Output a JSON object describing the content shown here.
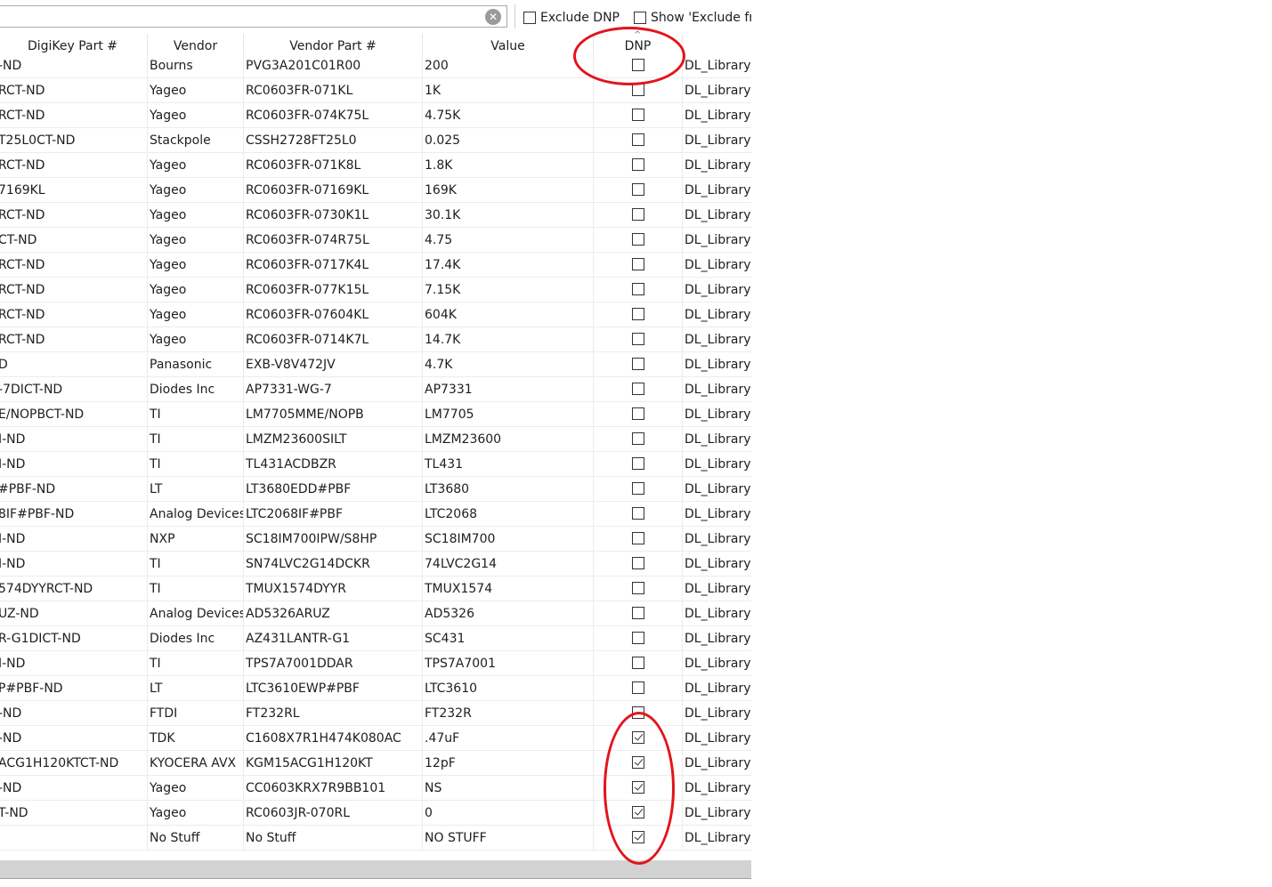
{
  "toolbar": {
    "search_value": "",
    "exclude_dnp_label": "Exclude DNP",
    "show_exclude_label": "Show 'Exclude fro"
  },
  "columns": [
    "DigiKey Part #",
    "Vendor",
    "Vendor Part #",
    "Value",
    "DNP"
  ],
  "rows": [
    {
      "digikey": "-ND",
      "vendor": "Bourns",
      "vendor_part": "PVG3A201C01R00",
      "value": "200",
      "dnp": false,
      "footprint": "DL_Library:"
    },
    {
      "digikey": "RCT-ND",
      "vendor": "Yageo",
      "vendor_part": "RC0603FR-071KL",
      "value": "1K",
      "dnp": false,
      "footprint": "DL_Library:"
    },
    {
      "digikey": "RCT-ND",
      "vendor": "Yageo",
      "vendor_part": "RC0603FR-074K75L",
      "value": "4.75K",
      "dnp": false,
      "footprint": "DL_Library:"
    },
    {
      "digikey": "T25L0CT-ND",
      "vendor": "Stackpole",
      "vendor_part": "CSSH2728FT25L0",
      "value": "0.025",
      "dnp": false,
      "footprint": "DL_Library:"
    },
    {
      "digikey": "RCT-ND",
      "vendor": "Yageo",
      "vendor_part": "RC0603FR-071K8L",
      "value": "1.8K",
      "dnp": false,
      "footprint": "DL_Library:"
    },
    {
      "digikey": "7169KL",
      "vendor": "Yageo",
      "vendor_part": "RC0603FR-07169KL",
      "value": "169K",
      "dnp": false,
      "footprint": "DL_Library:"
    },
    {
      "digikey": "RCT-ND",
      "vendor": "Yageo",
      "vendor_part": "RC0603FR-0730K1L",
      "value": "30.1K",
      "dnp": false,
      "footprint": "DL_Library:"
    },
    {
      "digikey": "CT-ND",
      "vendor": "Yageo",
      "vendor_part": "RC0603FR-074R75L",
      "value": "4.75",
      "dnp": false,
      "footprint": "DL_Library:"
    },
    {
      "digikey": "RCT-ND",
      "vendor": "Yageo",
      "vendor_part": "RC0603FR-0717K4L",
      "value": "17.4K",
      "dnp": false,
      "footprint": "DL_Library:"
    },
    {
      "digikey": "RCT-ND",
      "vendor": "Yageo",
      "vendor_part": "RC0603FR-077K15L",
      "value": "7.15K",
      "dnp": false,
      "footprint": "DL_Library:"
    },
    {
      "digikey": "RCT-ND",
      "vendor": "Yageo",
      "vendor_part": "RC0603FR-07604KL",
      "value": "604K",
      "dnp": false,
      "footprint": "DL_Library:"
    },
    {
      "digikey": "RCT-ND",
      "vendor": "Yageo",
      "vendor_part": "RC0603FR-0714K7L",
      "value": "14.7K",
      "dnp": false,
      "footprint": "DL_Library:"
    },
    {
      "digikey": "D",
      "vendor": "Panasonic",
      "vendor_part": "EXB-V8V472JV",
      "value": "4.7K",
      "dnp": false,
      "footprint": "DL_Library:"
    },
    {
      "digikey": "-7DICT-ND",
      "vendor": "Diodes Inc",
      "vendor_part": "AP7331-WG-7",
      "value": "AP7331",
      "dnp": false,
      "footprint": "DL_Library:"
    },
    {
      "digikey": "E/NOPBCT-ND",
      "vendor": "TI",
      "vendor_part": "LM7705MME/NOPB",
      "value": "LM7705",
      "dnp": false,
      "footprint": "DL_Library:"
    },
    {
      "digikey": "I-ND",
      "vendor": "TI",
      "vendor_part": "LMZM23600SILT",
      "value": "LMZM23600",
      "dnp": false,
      "footprint": "DL_Library:"
    },
    {
      "digikey": "I-ND",
      "vendor": "TI",
      "vendor_part": "TL431ACDBZR",
      "value": "TL431",
      "dnp": false,
      "footprint": "DL_Library:"
    },
    {
      "digikey": "#PBF-ND",
      "vendor": "LT",
      "vendor_part": "LT3680EDD#PBF",
      "value": "LT3680",
      "dnp": false,
      "footprint": "DL_Library:"
    },
    {
      "digikey": "8IF#PBF-ND",
      "vendor": "Analog Devices",
      "vendor_part": "LTC2068IF#PBF",
      "value": "LTC2068",
      "dnp": false,
      "footprint": "DL_Library:"
    },
    {
      "digikey": "I-ND",
      "vendor": "NXP",
      "vendor_part": "SC18IM700IPW/S8HP",
      "value": "SC18IM700",
      "dnp": false,
      "footprint": "DL_Library:"
    },
    {
      "digikey": "I-ND",
      "vendor": "TI",
      "vendor_part": "SN74LVC2G14DCKR",
      "value": "74LVC2G14",
      "dnp": false,
      "footprint": "DL_Library:"
    },
    {
      "digikey": "574DYYRCT-ND",
      "vendor": "TI",
      "vendor_part": "TMUX1574DYYR",
      "value": "TMUX1574",
      "dnp": false,
      "footprint": "DL_Library:"
    },
    {
      "digikey": "UZ-ND",
      "vendor": "Analog Devices",
      "vendor_part": "AD5326ARUZ",
      "value": "AD5326",
      "dnp": false,
      "footprint": "DL_Library:"
    },
    {
      "digikey": "R-G1DICT-ND",
      "vendor": "Diodes Inc",
      "vendor_part": "AZ431LANTR-G1",
      "value": "SC431",
      "dnp": false,
      "footprint": "DL_Library:"
    },
    {
      "digikey": "I-ND",
      "vendor": "TI",
      "vendor_part": "TPS7A7001DDAR",
      "value": "TPS7A7001",
      "dnp": false,
      "footprint": "DL_Library:"
    },
    {
      "digikey": "P#PBF-ND",
      "vendor": "LT",
      "vendor_part": "LTC3610EWP#PBF",
      "value": "LTC3610",
      "dnp": false,
      "footprint": "DL_Library:"
    },
    {
      "digikey": "-ND",
      "vendor": "FTDI",
      "vendor_part": "FT232RL",
      "value": "FT232R",
      "dnp": false,
      "footprint": "DL_Library:"
    },
    {
      "digikey": "-ND",
      "vendor": "TDK",
      "vendor_part": "C1608X7R1H474K080AC",
      "value": ".47uF",
      "dnp": true,
      "footprint": "DL_Library:"
    },
    {
      "digikey": "ACG1H120KTCT-ND",
      "vendor": "KYOCERA AVX",
      "vendor_part": "KGM15ACG1H120KT",
      "value": "12pF",
      "dnp": true,
      "footprint": "DL_Library:"
    },
    {
      "digikey": "-ND",
      "vendor": "Yageo",
      "vendor_part": "CC0603KRX7R9BB101",
      "value": "NS",
      "dnp": true,
      "footprint": "DL_Library:"
    },
    {
      "digikey": "T-ND",
      "vendor": "Yageo",
      "vendor_part": "RC0603JR-070RL",
      "value": "0",
      "dnp": true,
      "footprint": "DL_Library:"
    },
    {
      "digikey": "",
      "vendor": "No Stuff",
      "vendor_part": "No Stuff",
      "value": "NO STUFF",
      "dnp": true,
      "footprint": "DL_Library:"
    }
  ],
  "colors": {
    "annotation": "#e3141b",
    "scrollbar": "#d2d2d2"
  }
}
